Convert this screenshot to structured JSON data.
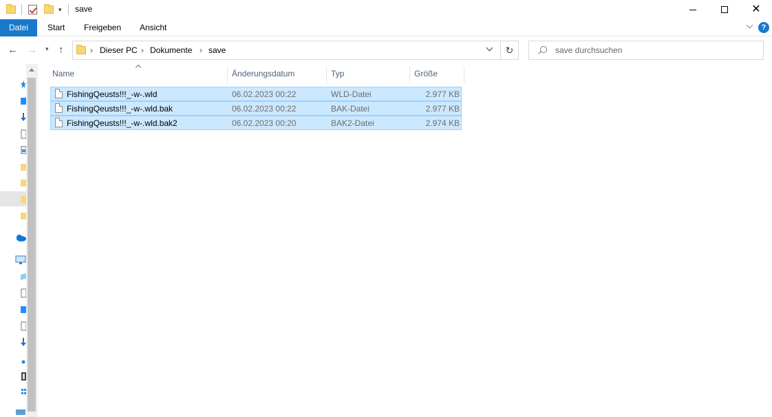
{
  "window": {
    "title": "save"
  },
  "ribbon": {
    "file_tab": "Datei",
    "tabs": [
      "Start",
      "Freigeben",
      "Ansicht"
    ],
    "help_label": "?"
  },
  "address": {
    "crumbs": [
      "Dieser PC",
      "Dokumente",
      "save"
    ]
  },
  "search": {
    "placeholder": "save durchsuchen"
  },
  "columns": {
    "name": "Name",
    "date": "Änderungsdatum",
    "type": "Typ",
    "size": "Größe"
  },
  "files": [
    {
      "name": "FishingQeusts!!!_-w-.wld",
      "date": "06.02.2023 00:22",
      "type": "WLD-Datei",
      "size": "2.977 KB"
    },
    {
      "name": "FishingQeusts!!!_-w-.wld.bak",
      "date": "06.02.2023 00:22",
      "type": "BAK-Datei",
      "size": "2.977 KB"
    },
    {
      "name": "FishingQeusts!!!_-w-.wld.bak2",
      "date": "06.02.2023 00:20",
      "type": "BAK2-Datei",
      "size": "2.974 KB"
    }
  ],
  "colors": {
    "accent": "#1979ca",
    "selection": "#cce8ff",
    "selection_border": "#99d1ff"
  },
  "icons": {
    "nav_pane": [
      "star-icon",
      "desktop-icon",
      "download-icon",
      "document-icon",
      "pictures-icon",
      "folder-icon",
      "folder-icon",
      "folder-icon",
      "folder-icon",
      "onedrive-icon",
      "this-pc-icon",
      "objects-3d-icon",
      "desktop-icon",
      "documents-icon",
      "downloads-icon",
      "music-icon",
      "videos-icon",
      "pictures-icon",
      "network-icon"
    ]
  }
}
